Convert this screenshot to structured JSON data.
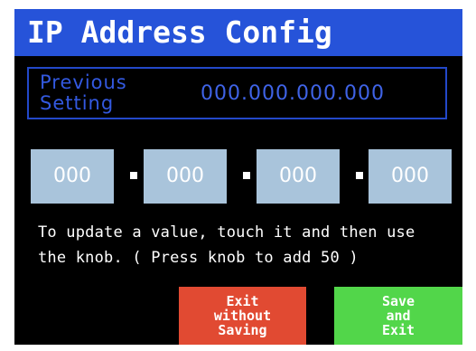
{
  "title": "IP Address Config",
  "previous": {
    "label_line1": "Previous",
    "label_line2": "Setting",
    "value": "000.000.000.000"
  },
  "octets": [
    "000",
    "000",
    "000",
    "000"
  ],
  "help": {
    "line1": "To update a value, touch it and then use",
    "line2": "the knob.  ( Press knob to add 50 )"
  },
  "buttons": {
    "exit": [
      "Exit",
      "without",
      "Saving"
    ],
    "save": [
      "Save",
      "and",
      "Exit"
    ]
  },
  "colors": {
    "title_bar": "#2653d9",
    "octet_box": "#a9c4db",
    "exit_button": "#e14a32",
    "save_button": "#52d64a"
  }
}
